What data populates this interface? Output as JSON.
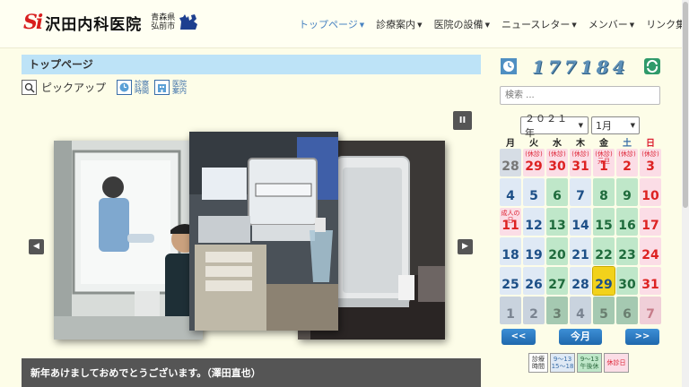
{
  "logo": {
    "mark": "Si",
    "name": "沢田内科医院",
    "location_line1": "青森県",
    "location_line2": "弘前市"
  },
  "nav": [
    {
      "label": "トップページ",
      "dropdown": true,
      "active": true
    },
    {
      "label": "診療案内",
      "dropdown": true
    },
    {
      "label": "医院の設備",
      "dropdown": true
    },
    {
      "label": "ニュースレター",
      "dropdown": true
    },
    {
      "label": "メンバー",
      "dropdown": true
    },
    {
      "label": "リンク集",
      "dropdown": false
    }
  ],
  "page_title": "トップページ",
  "pickup": {
    "label": "ピックアップ",
    "link_hours": "診察\n時間",
    "link_guide": "医院\n案内"
  },
  "slider": {
    "pause": "II",
    "prev": "◀",
    "next": "▶"
  },
  "news_title": "新年あけましておめでとうございます。（澤田直也）",
  "counter": "177184",
  "search": {
    "placeholder": "検索 ..."
  },
  "calendar": {
    "year": "２０２１年",
    "month": "1月",
    "weekdays": [
      "月",
      "火",
      "水",
      "木",
      "金",
      "土",
      "日"
    ],
    "weekday_colors": [
      "#222",
      "#222",
      "#222",
      "#222",
      "#222",
      "#3a6ea8",
      "#d23"
    ],
    "days": [
      {
        "d": "28",
        "type": "prev"
      },
      {
        "d": "29",
        "type": "holiday",
        "note": "(休診)"
      },
      {
        "d": "30",
        "type": "holiday",
        "note": "(休診)"
      },
      {
        "d": "31",
        "type": "holiday",
        "note": "(休診)"
      },
      {
        "d": "1",
        "type": "holiday",
        "note": "(休診)\n元旦"
      },
      {
        "d": "2",
        "type": "holiday",
        "note": "(休診)"
      },
      {
        "d": "3",
        "type": "holiday",
        "note": "(休診)"
      },
      {
        "d": "4",
        "type": "normal"
      },
      {
        "d": "5",
        "type": "normal"
      },
      {
        "d": "6",
        "type": "half"
      },
      {
        "d": "7",
        "type": "normal"
      },
      {
        "d": "8",
        "type": "half"
      },
      {
        "d": "9",
        "type": "half"
      },
      {
        "d": "10",
        "type": "sunday"
      },
      {
        "d": "11",
        "type": "holiday",
        "note": "成人の\n日"
      },
      {
        "d": "12",
        "type": "normal"
      },
      {
        "d": "13",
        "type": "half"
      },
      {
        "d": "14",
        "type": "normal"
      },
      {
        "d": "15",
        "type": "half"
      },
      {
        "d": "16",
        "type": "half"
      },
      {
        "d": "17",
        "type": "sunday"
      },
      {
        "d": "18",
        "type": "normal"
      },
      {
        "d": "19",
        "type": "normal"
      },
      {
        "d": "20",
        "type": "half"
      },
      {
        "d": "21",
        "type": "normal"
      },
      {
        "d": "22",
        "type": "half"
      },
      {
        "d": "23",
        "type": "half"
      },
      {
        "d": "24",
        "type": "sunday"
      },
      {
        "d": "25",
        "type": "normal"
      },
      {
        "d": "26",
        "type": "normal"
      },
      {
        "d": "27",
        "type": "half"
      },
      {
        "d": "28",
        "type": "normal"
      },
      {
        "d": "29",
        "type": "today"
      },
      {
        "d": "30",
        "type": "half"
      },
      {
        "d": "31",
        "type": "sunday"
      },
      {
        "d": "1",
        "type": "next"
      },
      {
        "d": "2",
        "type": "next"
      },
      {
        "d": "3",
        "type": "next-half"
      },
      {
        "d": "4",
        "type": "next"
      },
      {
        "d": "5",
        "type": "next-half"
      },
      {
        "d": "6",
        "type": "next-half"
      },
      {
        "d": "7",
        "type": "next-sunday"
      }
    ],
    "prev_label": "<<",
    "today_label": "今月",
    "next_label": ">>"
  },
  "legend": {
    "label": "診療\n時間",
    "a": "9～13\n15～18",
    "b": "9～13\n午後休",
    "c": "休診日"
  },
  "colors": {
    "accent": "#4a84c2",
    "title_bar": "#bde3f7",
    "normal_day": "#dfe9f5",
    "half_day": "#bfe7c9",
    "holiday": "#fbdde6",
    "today": "#f2d21b"
  }
}
